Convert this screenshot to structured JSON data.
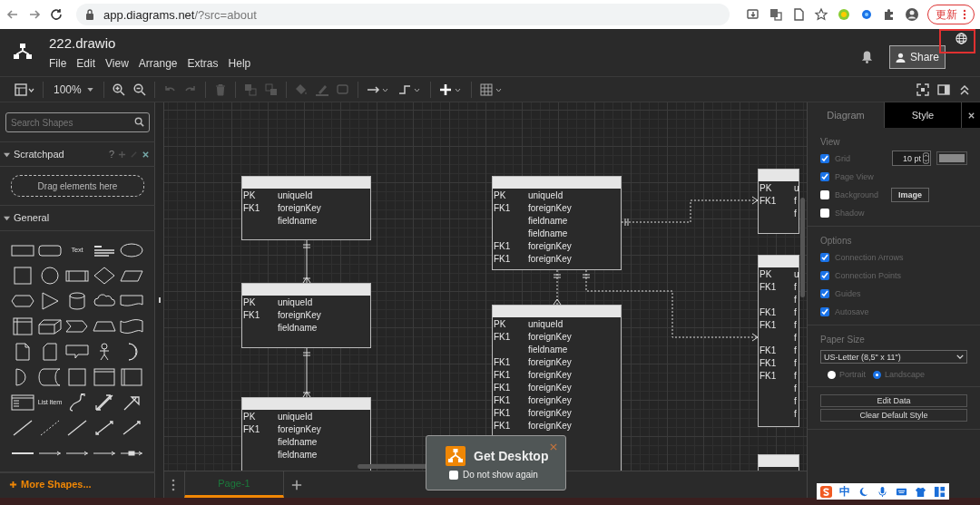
{
  "browser": {
    "url_host": "app.diagrams.net",
    "url_path": "/?src=about",
    "update_button": "更新"
  },
  "app": {
    "title": "222.drawio",
    "menu": [
      "File",
      "Edit",
      "View",
      "Arrange",
      "Extras",
      "Help"
    ],
    "share_button": "Share"
  },
  "toolbar": {
    "zoom": "100%"
  },
  "sidebar": {
    "search": {
      "placeholder": "Search Shapes"
    },
    "scratchpad": {
      "title": "Scratchpad",
      "expanded": true,
      "help": "?",
      "drop_hint": "Drag elements here"
    },
    "general": {
      "title": "General",
      "expanded": true,
      "shape_labels": [
        "Text",
        "List Item"
      ]
    },
    "more_shapes": "More Shapes..."
  },
  "diagram": {
    "tables": [
      {
        "kind": "entity",
        "rows": [
          {
            "key": "PK",
            "field": "uniqueId"
          },
          {
            "key": "FK1",
            "field": "foreignKey"
          },
          {
            "key": "",
            "field": "fieldname"
          }
        ]
      },
      {
        "kind": "entity",
        "rows": [
          {
            "key": "PK",
            "field": "uniqueId"
          },
          {
            "key": "FK1",
            "field": "foreignKey"
          },
          {
            "key": "",
            "field": "fieldname"
          }
        ]
      },
      {
        "kind": "entity",
        "rows": [
          {
            "key": "PK",
            "field": "uniqueId"
          },
          {
            "key": "FK1",
            "field": "foreignKey"
          },
          {
            "key": "",
            "field": "fieldname"
          },
          {
            "key": "",
            "field": "fieldname"
          }
        ]
      },
      {
        "kind": "entity",
        "rows": [
          {
            "key": "PK",
            "field": "uniqueId"
          },
          {
            "key": "FK1",
            "field": "foreignKey"
          },
          {
            "key": "",
            "field": "fieldname"
          },
          {
            "key": "",
            "field": "fieldname"
          },
          {
            "key": "FK1",
            "field": "foreignKey"
          },
          {
            "key": "FK1",
            "field": "foreignKey"
          }
        ]
      },
      {
        "kind": "entity",
        "rows": [
          {
            "key": "PK",
            "field": "uniqueId"
          },
          {
            "key": "FK1",
            "field": "foreignKey"
          },
          {
            "key": "",
            "field": "fieldname"
          },
          {
            "key": "FK1",
            "field": "foreignKey"
          },
          {
            "key": "FK1",
            "field": "foreignKey"
          },
          {
            "key": "FK1",
            "field": "foreignKey"
          },
          {
            "key": "FK1",
            "field": "foreignKey"
          },
          {
            "key": "FK1",
            "field": "foreignKey"
          },
          {
            "key": "FK1",
            "field": "foreignKey"
          }
        ]
      },
      {
        "kind": "entity",
        "rows": [
          {
            "key": "PK",
            "field": "u"
          },
          {
            "key": "FK1",
            "field": "f"
          },
          {
            "key": "",
            "field": "f"
          }
        ]
      },
      {
        "kind": "entity",
        "rows": [
          {
            "key": "PK",
            "field": "u"
          },
          {
            "key": "FK1",
            "field": "f"
          },
          {
            "key": "",
            "field": "f"
          },
          {
            "key": "FK1",
            "field": "f"
          },
          {
            "key": "FK1",
            "field": "f"
          },
          {
            "key": "",
            "field": "f"
          },
          {
            "key": "FK1",
            "field": "f"
          },
          {
            "key": "FK1",
            "field": "f"
          },
          {
            "key": "FK1",
            "field": "f"
          },
          {
            "key": "",
            "field": "f"
          },
          {
            "key": "",
            "field": "f"
          },
          {
            "key": "",
            "field": "f"
          }
        ]
      },
      {
        "kind": "entity"
      }
    ]
  },
  "pages": [
    {
      "label": "Page-1",
      "selected": true
    }
  ],
  "popup": {
    "title": "Get Desktop",
    "checkbox": {
      "label": "Do not show again",
      "checked": false
    }
  },
  "format_panel": {
    "tabs": [
      {
        "label": "Diagram",
        "selected": true
      },
      {
        "label": "Style",
        "selected": false
      }
    ],
    "view": {
      "title": "View",
      "options": [
        {
          "label": "Grid",
          "checked": true
        },
        {
          "label": "Page View",
          "checked": true
        },
        {
          "label": "Background",
          "checked": false
        },
        {
          "label": "Shadow",
          "checked": false
        }
      ],
      "grid_size": "10 pt",
      "image_button": "Image"
    },
    "options": {
      "title": "Options",
      "items": [
        {
          "label": "Connection Arrows",
          "checked": true
        },
        {
          "label": "Connection Points",
          "checked": true
        },
        {
          "label": "Guides",
          "checked": true
        },
        {
          "label": "Autosave",
          "checked": true
        }
      ]
    },
    "paper": {
      "title": "Paper Size",
      "size": "US-Letter (8,5\" x 11\")",
      "orientations": [
        {
          "label": "Portrait",
          "selected": false
        },
        {
          "label": "Landscape",
          "selected": true
        }
      ]
    },
    "buttons": [
      "Edit Data",
      "Clear Default Style"
    ]
  },
  "ime": {
    "label": "中"
  }
}
